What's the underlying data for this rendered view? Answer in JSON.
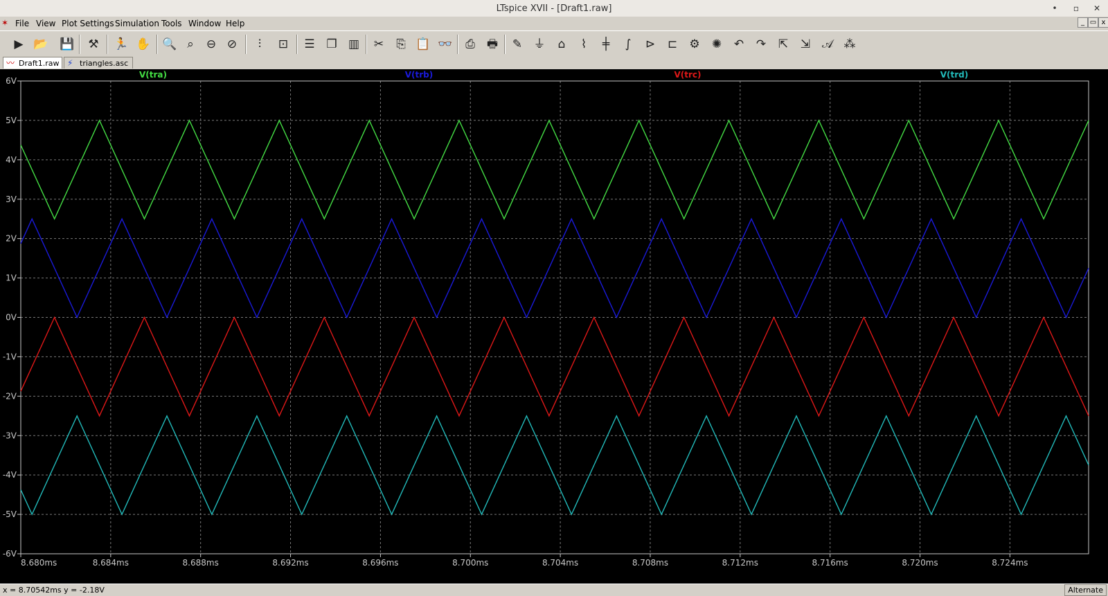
{
  "window": {
    "title": "LTspice XVII - [Draft1.raw]",
    "minimize": "•",
    "restore": "▫",
    "close": "✕"
  },
  "menu": {
    "items": [
      "File",
      "View",
      "Plot Settings",
      "Simulation",
      "Tools",
      "Window",
      "Help"
    ]
  },
  "mdi_controls": {
    "minimize": "_",
    "restore": "▭",
    "close": "x"
  },
  "toolbar": {
    "icons": [
      "run-icon",
      "open-icon",
      "save-icon",
      "control-panel-icon",
      "run-man-icon",
      "halt-hand-icon",
      "zoom-in-icon",
      "zoom-pan-icon",
      "zoom-out-icon",
      "zoom-cancel-icon",
      "autoscale-icon",
      "pick-trace-icon",
      "tile-horizontal-icon",
      "cascade-icon",
      "tile-vertical-icon",
      "cut-icon",
      "copy-icon",
      "paste-icon",
      "find-icon",
      "print-icon",
      "print-setup-icon",
      "wire-icon",
      "ground-icon",
      "label-net-icon",
      "resistor-icon",
      "capacitor-icon",
      "inductor-icon",
      "diode-icon",
      "component-icon",
      "rotate-icon",
      "mirror-icon",
      "undo-icon",
      "redo-icon",
      "move-icon",
      "drag-icon",
      "text-icon",
      "spice-directive-icon"
    ]
  },
  "tabs": [
    {
      "label": "Draft1.raw",
      "active": true,
      "icon": "waveform-tab-icon"
    },
    {
      "label": "triangles.asc",
      "active": false,
      "icon": "schematic-tab-icon"
    }
  ],
  "chart_data": {
    "type": "line",
    "xlim": [
      8.68,
      8.7275
    ],
    "ylim": [
      -6,
      6
    ],
    "x_ticks": [
      "8.680ms",
      "8.684ms",
      "8.688ms",
      "8.692ms",
      "8.696ms",
      "8.700ms",
      "8.704ms",
      "8.708ms",
      "8.712ms",
      "8.716ms",
      "8.720ms",
      "8.724ms"
    ],
    "y_ticks": [
      "6V",
      "5V",
      "4V",
      "3V",
      "2V",
      "1V",
      "0V",
      "-1V",
      "-2V",
      "-3V",
      "-4V",
      "-5V",
      "-6V"
    ],
    "grid": true,
    "period_ms": 0.004,
    "series": [
      {
        "name": "V(tra)",
        "color": "#44dd44",
        "min": 2.5,
        "max": 5,
        "first_peak_ms": 8.6835
      },
      {
        "name": "V(trb)",
        "color": "#1a1adb",
        "min": 0,
        "max": 2.5,
        "first_peak_ms": 8.6805
      },
      {
        "name": "V(trc)",
        "color": "#e01818",
        "min": -2.5,
        "max": 0,
        "first_peak_ms": 8.6815
      },
      {
        "name": "V(trd)",
        "color": "#22bbbb",
        "min": -5,
        "max": -2.5,
        "first_peak_ms": 8.6825
      }
    ]
  },
  "status": {
    "coords": "x = 8.70542ms   y = -2.18V",
    "mode": "Alternate"
  }
}
